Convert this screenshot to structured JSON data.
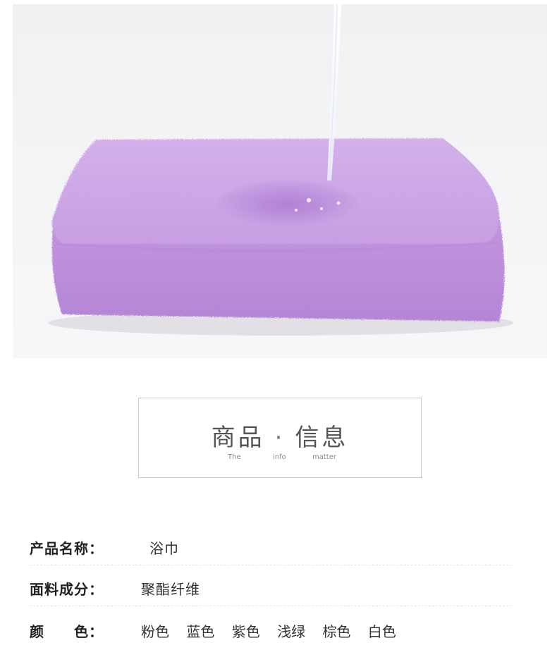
{
  "hero": {
    "image_subject": "towel-with-water-stream-icon",
    "towel_color": "#c8a2e0",
    "background_color": "#f3f2f4"
  },
  "info_card": {
    "title_left": "商品",
    "title_dot": "·",
    "title_right": "信息",
    "sub_1": "The",
    "sub_2": "info",
    "sub_3": "matter"
  },
  "specs": {
    "name_label": "产品名称：",
    "name_value": "浴巾",
    "material_label": "面料成分：",
    "material_value": "聚酯纤维",
    "color_label": "颜　　色：",
    "colors": [
      "粉色",
      "蓝色",
      "紫色",
      "浅绿",
      "棕色",
      "白色"
    ]
  }
}
